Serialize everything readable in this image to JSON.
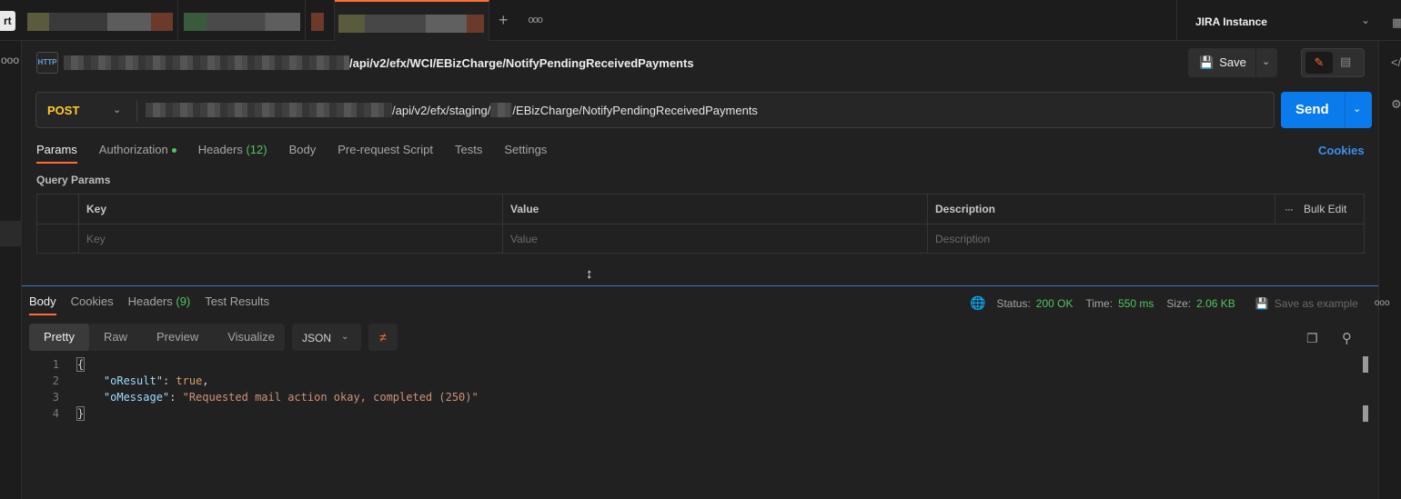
{
  "left_label": "rt",
  "tabs": {
    "new_tab_symbol": "+",
    "more_symbol": "ooo"
  },
  "environment": {
    "name": "JIRA Instance"
  },
  "request": {
    "badge": "HTTP",
    "title_path": "/api/v2/efx/WCI/EBizCharge/NotifyPendingReceivedPayments",
    "save_label": "Save",
    "method": "POST",
    "url_part1": "/api/v2/efx/staging/",
    "url_part2": "/EBizCharge/NotifyPendingReceivedPayments",
    "send_label": "Send"
  },
  "request_tabs": {
    "params": "Params",
    "authorization": "Authorization",
    "headers": "Headers",
    "headers_count": "(12)",
    "body": "Body",
    "prerequest": "Pre-request Script",
    "tests": "Tests",
    "settings": "Settings",
    "cookies": "Cookies"
  },
  "query_params": {
    "label": "Query Params",
    "columns": [
      "Key",
      "Value",
      "Description"
    ],
    "placeholders": [
      "Key",
      "Value",
      "Description"
    ],
    "bulk_edit": "Bulk Edit"
  },
  "response": {
    "tabs": {
      "body": "Body",
      "cookies": "Cookies",
      "headers": "Headers",
      "headers_count": "(9)",
      "test_results": "Test Results"
    },
    "status_label": "Status:",
    "status_value": "200 OK",
    "time_label": "Time:",
    "time_value": "550 ms",
    "size_label": "Size:",
    "size_value": "2.06 KB",
    "save_example": "Save as example",
    "views": [
      "Pretty",
      "Raw",
      "Preview",
      "Visualize"
    ],
    "format": "JSON",
    "lines": [
      {
        "n": "1",
        "open": "{"
      },
      {
        "n": "2",
        "key": "\"oResult\"",
        "colon": ": ",
        "value": "true",
        "comma": ","
      },
      {
        "n": "3",
        "key": "\"oMessage\"",
        "colon": ": ",
        "value": "\"Requested mail action okay, completed (250)\""
      },
      {
        "n": "4",
        "close": "}"
      }
    ]
  },
  "colors": {
    "accent": "#ff6c37",
    "send": "#097bed",
    "method_post": "#ffcb2f",
    "success": "#53c45e",
    "link": "#3d8fe8"
  }
}
